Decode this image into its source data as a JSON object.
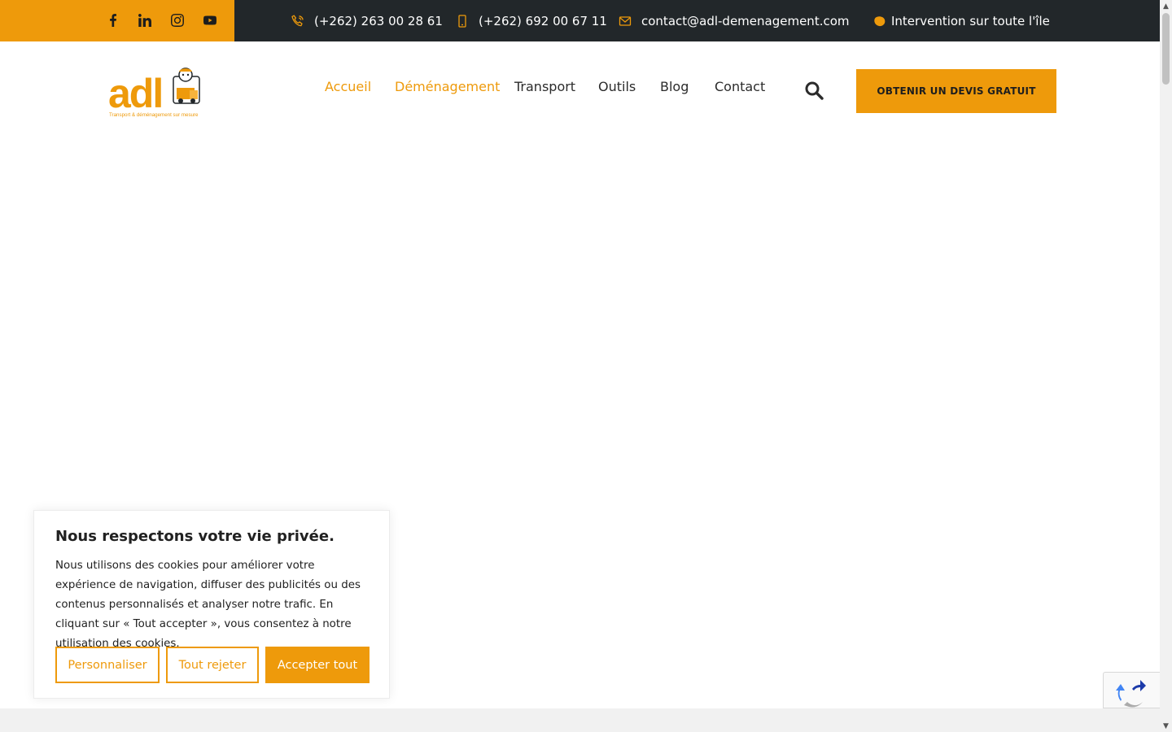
{
  "topbar": {
    "social": [
      {
        "name": "facebook-icon"
      },
      {
        "name": "linkedin-icon"
      },
      {
        "name": "instagram-icon"
      },
      {
        "name": "youtube-icon"
      }
    ],
    "phone1": "(+262) 263 00 28 61",
    "phone2": "(+262) 692 00 67 11",
    "email": "contact@adl-demenagement.com",
    "coverage": "Intervention sur toute l'île"
  },
  "brand": {
    "logo_text": "adl",
    "tagline": "Transport & déménagement sur mesure",
    "accent_color": "#ee9a0b",
    "dark_color": "#22272a"
  },
  "nav": {
    "items": [
      {
        "label": "Accueil",
        "active": true
      },
      {
        "label": "Déménagement",
        "active": true
      },
      {
        "label": "Transport",
        "active": false
      },
      {
        "label": "Outils",
        "active": false
      },
      {
        "label": "Blog",
        "active": false
      },
      {
        "label": "Contact",
        "active": false
      }
    ],
    "cta_label": "OBTENIR UN DEVIS GRATUIT"
  },
  "cookie": {
    "title": "Nous respectons votre vie privée.",
    "text": "Nous utilisons des cookies pour améliorer votre expérience de navigation, diffuser des publicités ou des contenus personnalisés et analyser notre trafic. En cliquant sur « Tout accepter », vous consentez à notre utilisation des cookies.",
    "customize_label": "Personnaliser",
    "reject_label": "Tout rejeter",
    "accept_label": "Accepter tout"
  }
}
